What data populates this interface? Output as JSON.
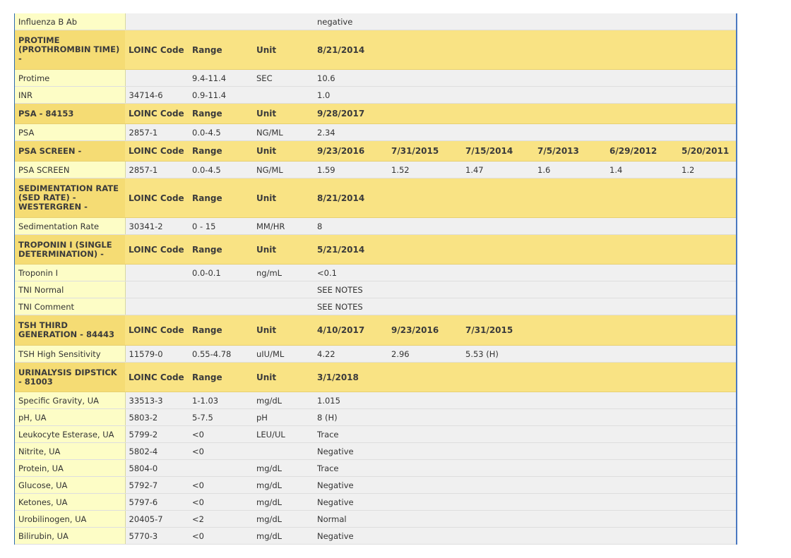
{
  "rows": [
    {
      "type": "row",
      "cells": [
        "Influenza B Ab",
        "",
        "",
        "",
        "negative",
        "",
        "",
        "",
        "",
        ""
      ]
    },
    {
      "type": "hdr",
      "h": 55,
      "cells": [
        "PROTIME (PROTHROMBIN TIME) -",
        "LOINC Code",
        "Range",
        "Unit",
        "8/21/2014",
        "",
        "",
        "",
        "",
        ""
      ]
    },
    {
      "type": "row",
      "cells": [
        "Protime",
        "",
        "9.4-11.4",
        "SEC",
        "10.6",
        "",
        "",
        "",
        "",
        ""
      ]
    },
    {
      "type": "row",
      "cells": [
        "INR",
        "34714-6",
        "0.9-11.4",
        "",
        "1.0",
        "",
        "",
        "",
        "",
        ""
      ]
    },
    {
      "type": "hdr",
      "h": 28,
      "cells": [
        "PSA - 84153",
        "LOINC Code",
        "Range",
        "Unit",
        "9/28/2017",
        "",
        "",
        "",
        "",
        ""
      ]
    },
    {
      "type": "row",
      "cells": [
        "PSA",
        "2857-1",
        "0.0-4.5",
        "NG/ML",
        "2.34",
        "",
        "",
        "",
        "",
        ""
      ]
    },
    {
      "type": "hdr",
      "h": 28,
      "cells": [
        "PSA SCREEN -",
        "LOINC Code",
        "Range",
        "Unit",
        "9/23/2016",
        "7/31/2015",
        "7/15/2014",
        "7/5/2013",
        "6/29/2012",
        "5/20/2011"
      ]
    },
    {
      "type": "row",
      "cells": [
        "PSA SCREEN",
        "2857-1",
        "0.0-4.5",
        "NG/ML",
        "1.59",
        "1.52",
        "1.47",
        "1.6",
        "1.4",
        "1.2"
      ]
    },
    {
      "type": "hdr",
      "h": 55,
      "cells": [
        "SEDIMENTATION RATE (SED RATE) - WESTERGREN -",
        "LOINC Code",
        "Range",
        "Unit",
        "8/21/2014",
        "",
        "",
        "",
        "",
        ""
      ]
    },
    {
      "type": "row",
      "cells": [
        "Sedimentation Rate",
        "30341-2",
        "0 - 15",
        "MM/HR",
        "8",
        "",
        "",
        "",
        "",
        ""
      ]
    },
    {
      "type": "hdr",
      "h": 41,
      "cells": [
        "TROPONIN I (SINGLE DETERMINATION) -",
        "LOINC Code",
        "Range",
        "Unit",
        "5/21/2014",
        "",
        "",
        "",
        "",
        ""
      ]
    },
    {
      "type": "row",
      "cells": [
        "Troponin I",
        "",
        "0.0-0.1",
        "ng/mL",
        "<0.1",
        "",
        "",
        "",
        "",
        ""
      ]
    },
    {
      "type": "row",
      "cells": [
        "TNI Normal",
        "",
        "",
        "",
        "SEE NOTES",
        "",
        "",
        "",
        "",
        ""
      ]
    },
    {
      "type": "row",
      "cells": [
        "TNI Comment",
        "",
        "",
        "",
        "SEE NOTES",
        "",
        "",
        "",
        "",
        ""
      ]
    },
    {
      "type": "hdr",
      "h": 42,
      "cells": [
        "TSH THIRD GENERATION - 84443",
        "LOINC Code",
        "Range",
        "Unit",
        "4/10/2017",
        "9/23/2016",
        "7/31/2015",
        "",
        "",
        ""
      ]
    },
    {
      "type": "row",
      "cells": [
        "TSH High Sensitivity",
        "11579-0",
        "0.55-4.78",
        "uIU/ML",
        "4.22",
        "2.96",
        "5.53 (H)",
        "",
        "",
        ""
      ]
    },
    {
      "type": "hdr",
      "h": 41,
      "cells": [
        "URINALYSIS DIPSTICK - 81003",
        "LOINC Code",
        "Range",
        "Unit",
        "3/1/2018",
        "",
        "",
        "",
        "",
        ""
      ]
    },
    {
      "type": "row",
      "cells": [
        "Specific Gravity, UA",
        "33513-3",
        "1-1.03",
        "mg/dL",
        "1.015",
        "",
        "",
        "",
        "",
        ""
      ]
    },
    {
      "type": "row",
      "cells": [
        "pH, UA",
        "5803-2",
        "5-7.5",
        "pH",
        "8 (H)",
        "",
        "",
        "",
        "",
        ""
      ]
    },
    {
      "type": "row",
      "cells": [
        "Leukocyte Esterase, UA",
        "5799-2",
        "<0",
        "LEU/UL",
        "Trace",
        "",
        "",
        "",
        "",
        ""
      ]
    },
    {
      "type": "row",
      "cells": [
        "Nitrite, UA",
        "5802-4",
        "<0",
        "",
        "Negative",
        "",
        "",
        "",
        "",
        ""
      ]
    },
    {
      "type": "row",
      "cells": [
        "Protein, UA",
        "5804-0",
        "",
        "mg/dL",
        "Trace",
        "",
        "",
        "",
        "",
        ""
      ]
    },
    {
      "type": "row",
      "cells": [
        "Glucose, UA",
        "5792-7",
        "<0",
        "mg/dL",
        "Negative",
        "",
        "",
        "",
        "",
        ""
      ]
    },
    {
      "type": "row",
      "cells": [
        "Ketones, UA",
        "5797-6",
        "<0",
        "mg/dL",
        "Negative",
        "",
        "",
        "",
        "",
        ""
      ]
    },
    {
      "type": "row",
      "cells": [
        "Urobilinogen, UA",
        "20405-7",
        "<2",
        "mg/dL",
        "Normal",
        "",
        "",
        "",
        "",
        ""
      ]
    },
    {
      "type": "row",
      "cells": [
        "Bilirubin, UA",
        "5770-3",
        "<0",
        "mg/dL",
        "Negative",
        "",
        "",
        "",
        "",
        ""
      ]
    }
  ]
}
